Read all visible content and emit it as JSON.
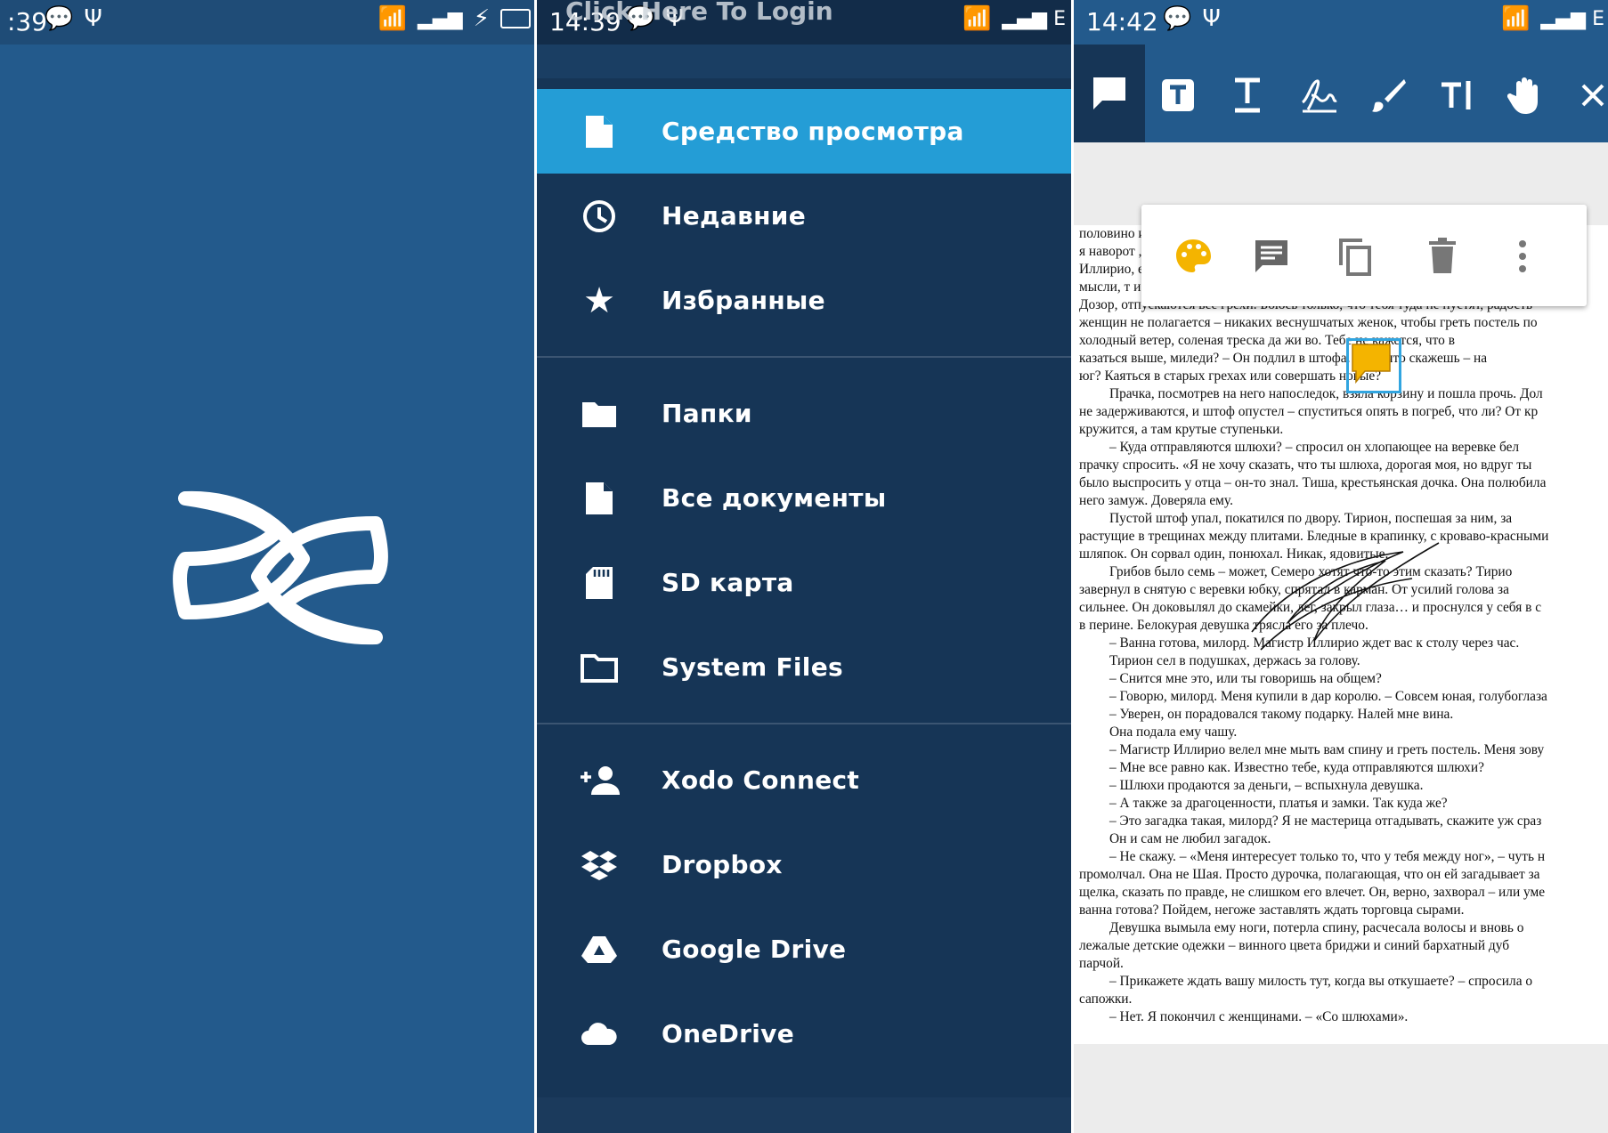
{
  "splash": {
    "status": {
      "time": ":39"
    },
    "brand_color": "#235a8c"
  },
  "drawer": {
    "status": {
      "time": "14:39"
    },
    "overlay_text": "Click Here To Login",
    "items_primary": [
      {
        "label": "Средство просмотра",
        "icon": "document-icon",
        "active": true
      },
      {
        "label": "Недавние",
        "icon": "clock-icon"
      },
      {
        "label": "Избранные",
        "icon": "star-icon"
      }
    ],
    "items_storage": [
      {
        "label": "Папки",
        "icon": "folder-icon"
      },
      {
        "label": "Все документы",
        "icon": "document-icon"
      },
      {
        "label": "SD карта",
        "icon": "sd-card-icon"
      },
      {
        "label": "System Files",
        "icon": "folder-outline-icon"
      }
    ],
    "items_cloud": [
      {
        "label": "Xodo Connect",
        "icon": "add-person-icon"
      },
      {
        "label": "Dropbox",
        "icon": "dropbox-icon"
      },
      {
        "label": "Google Drive",
        "icon": "google-drive-icon"
      },
      {
        "label": "OneDrive",
        "icon": "onedrive-icon"
      }
    ],
    "active_color": "#249dd6"
  },
  "viewer": {
    "status": {
      "time": "14:42"
    },
    "toolbar_icons": [
      "sticky-note-icon",
      "free-text-icon",
      "underline-text-icon",
      "signature-icon",
      "freehand-brush-icon",
      "text-cursor-icon",
      "pan-hand-icon",
      "close-icon"
    ],
    "popup_icons": [
      "palette-icon",
      "comment-icon",
      "copy-icon",
      "delete-icon",
      "more-icon"
    ],
    "note_color": "#f4b400",
    "lines": [
      "половино                                                                                        ица?",
      "я наворот                                                                                       , пр",
      "Иллирио,                                                                                       ет-н",
      "мысли, т                                                                                       исту",
      "Дозор, отпускаются все грехи. Боюсь только, что тебя туда не пустят, радость",
      "женщин не полагается – никаких веснушчатых женок, чтобы греть постель по",
      "холодный ветер, соленая треска да жи         во. Тебе не кажется, что в",
      "казаться выше, миледи? – Он подлил в          штофа. – Ну, что скажешь – на",
      "юг? Каяться в старых грехах или совершать новые?",
      "Прачка, посмотрев на него напоследок, взяла корзину и пошла прочь. Дол",
      "не задерживаются, и штоф опустел – спуститься опять в погреб, что ли? От кр",
      "кружится, а там крутые ступеньки.",
      "– Куда отправляются шлюхи? – спросил он хлопающее на веревке бел",
      "прачку спросить. «Я не хочу сказать, что ты шлюха, дорогая моя, но вдруг ты",
      "было выспросить у отца – он-то знал. Тиша, крестьянская дочка. Она полюбила",
      "него замуж. Доверяла ему.",
      "Пустой штоф упал, покатился по двору. Тирион, поспешая за ним, за",
      "растущие в трещинах между плитами. Бледные в крапинку, с кроваво-красными",
      "шляпок. Он сорвал один, понюхал. Никак, ядовитые.",
      "Грибов было семь – может, Семеро хотят что-то этим сказать? Тирио",
      "завернул в снятую с веревки юбку, спрятал в карман. От усилий голова за",
      "сильнее. Он доковылял до скамейки, лег, закрыл глаза… и проснулся у себя в с",
      "в перине. Белокурая девушка трясла его за плечо.",
      "– Ванна готова, милорд. Магистр Иллирио ждет вас к столу через час.",
      "Тирион сел в подушках, держась за голову.",
      "– Снится мне это, или ты говоришь на общем?",
      "– Говорю, милорд. Меня купили в дар королю. – Совсем юная, голубоглаза",
      "– Уверен, он порадовался такому подарку. Налей мне вина.",
      "Она подала ему чашу.",
      "– Магистр Иллирио велел мне мыть вам спину и греть постель. Меня зову",
      "– Мне все равно как. Известно тебе, куда отправляются шлюхи?",
      "– Шлюхи продаются за деньги, – вспыхнула девушка.",
      "– А также за драгоценности, платья и замки. Так куда же?",
      "– Это загадка такая, милорд? Я не мастерица отгадывать, скажите уж сраз",
      "Он и сам не любил загадок.",
      "– Не скажу. – «Меня интересует только то, что у тебя между ног», – чуть н",
      "промолчал. Она не Шая. Просто дурочка, полагающая, что он ей загадывает за",
      "щелка, сказать по правде, не слишком его влечет. Он, верно, захворал – или уме",
      "ванна готова? Пойдем, негоже заставлять ждать торговца сырами.",
      "Девушка вымыла ему ноги, потерла спину, расчесала волосы и вновь о",
      "лежалые детские одежки – винного цвета бриджи и синий бархатный дуб",
      "парчой.",
      "– Прикажете ждать вашу милость тут, когда вы откушаете? – спросила о",
      "сапожки.",
      "– Нет. Я покончил с женщинами. – «Со шлюхами»."
    ],
    "indented_lines": [
      9,
      12,
      16,
      19,
      23,
      24,
      25,
      26,
      27,
      28,
      29,
      30,
      31,
      32,
      33,
      34,
      35,
      39,
      42,
      44
    ]
  }
}
